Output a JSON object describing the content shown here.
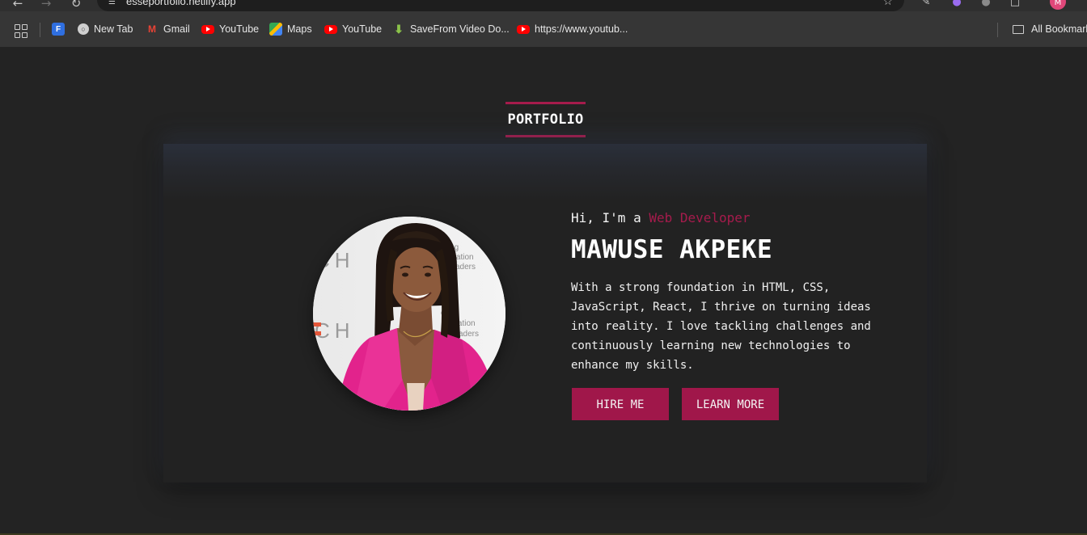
{
  "browser": {
    "url": "esseportfolio.netlify.app",
    "bookmarks": [
      {
        "label": "New Tab",
        "icon": "globe-icon"
      },
      {
        "label": "Gmail",
        "icon": "gmail-icon"
      },
      {
        "label": "YouTube",
        "icon": "youtube-icon"
      },
      {
        "label": "Maps",
        "icon": "maps-icon"
      },
      {
        "label": "YouTube",
        "icon": "youtube-icon"
      },
      {
        "label": "SaveFrom Video Do...",
        "icon": "download-icon"
      },
      {
        "label": "https://www.youtub...",
        "icon": "youtube-icon"
      }
    ],
    "all_bookmarks_label": "All Bookmark",
    "profile_initial": "M"
  },
  "site": {
    "section_title": "PORTFOLIO",
    "hero": {
      "greeting_prefix": "Hi, I'm a ",
      "role": "Web Developer",
      "name": "MAWUSE AKPEKE",
      "bio": "With a strong foundation in HTML, CSS, JavaScript, React, I thrive on turning ideas into reality. I love tackling challenges and continuously learning new technologies to enhance my skills.",
      "buttons": {
        "hire": "HIRE ME",
        "learn": "LEARN MORE"
      },
      "photo_banner_text": [
        "ering",
        "eration",
        "aders"
      ],
      "photo_banner_logo": "CH"
    }
  },
  "colors": {
    "accent": "#a61b4c",
    "background": "#232323",
    "card": "#222222",
    "jacket": "#e2238c"
  }
}
